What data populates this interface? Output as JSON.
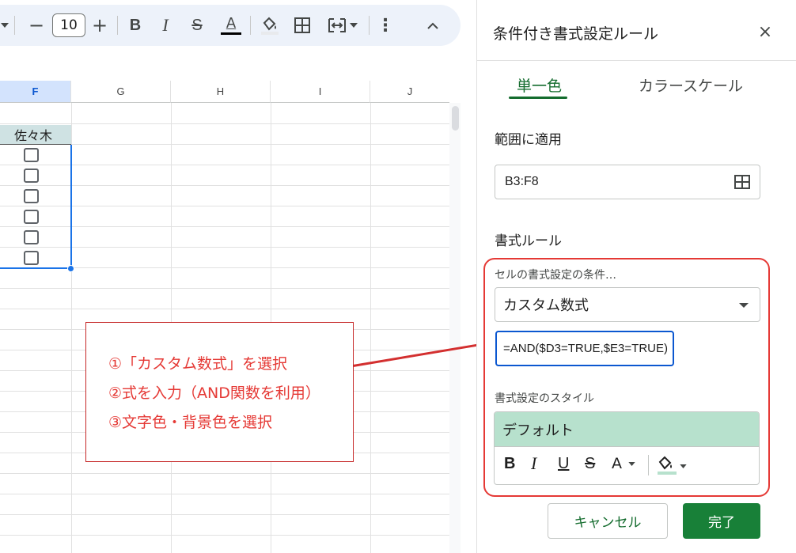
{
  "toolbar": {
    "font_size": "10",
    "minus": "−",
    "plus": "+",
    "bold": "B",
    "italic": "I",
    "strike": "S",
    "text_color": "A",
    "more": "⋮",
    "collapse": "⌃"
  },
  "grid": {
    "columns": [
      "F",
      "G",
      "H",
      "I",
      "J"
    ],
    "selected_column": "F",
    "header_cell": "佐々木",
    "checkbox_count": 6
  },
  "annotation": {
    "lines": [
      "①「カスタム数式」を選択",
      "②式を入力（AND関数を利用）",
      "③文字色・背景色を選択"
    ]
  },
  "panel": {
    "title": "条件付き書式設定ルール",
    "close": "×",
    "tabs": [
      "単一色",
      "カラースケール"
    ],
    "range_label": "範囲に適用",
    "range_value": "B3:F8",
    "rules_label": "書式ルール",
    "condition_label": "セルの書式設定の条件…",
    "condition_value": "カスタム数式",
    "formula": "=AND($D3=TRUE,$E3=TRUE)",
    "style_label": "書式設定のスタイル",
    "style_preview": "デフォルト",
    "style_tools": {
      "bold": "B",
      "italic": "I",
      "underline": "U",
      "strike": "S",
      "text_color": "A"
    },
    "cancel": "キャンセル",
    "done": "完了"
  },
  "colors": {
    "accent_green": "#146c2e",
    "done_button": "#188038",
    "preview_fill": "#b7e1cd",
    "annotation_red": "#e53935",
    "selection_blue": "#1a73e8"
  }
}
